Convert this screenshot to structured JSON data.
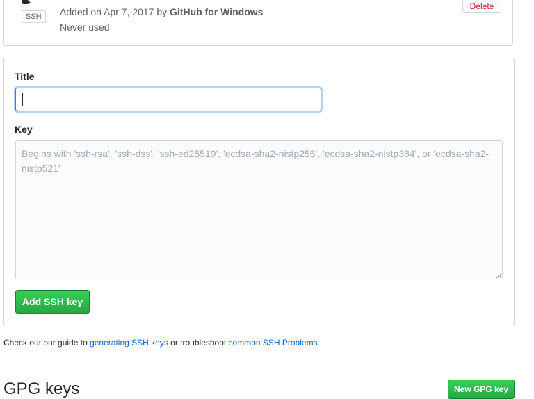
{
  "existing_key": {
    "badge": "SSH",
    "added_prefix": "Added on Apr 7, 2017 by ",
    "added_by": "GitHub for Windows",
    "usage": "Never used",
    "delete_label": "Delete"
  },
  "form": {
    "title_label": "Title",
    "title_value": "",
    "key_label": "Key",
    "key_placeholder": "Begins with 'ssh-rsa', 'ssh-dss', 'ssh-ed25519', 'ecdsa-sha2-nistp256', 'ecdsa-sha2-nistp384', or 'ecdsa-sha2-nistp521'",
    "submit_label": "Add SSH key"
  },
  "guide": {
    "prefix": "Check out our guide to ",
    "link1": "generating SSH keys",
    "middle": " or troubleshoot ",
    "link2": "common SSH Problems",
    "suffix": "."
  },
  "gpg": {
    "heading": "GPG keys",
    "new_button": "New GPG key"
  },
  "colors": {
    "accent_green": "#28a745",
    "link_blue": "#0366d6",
    "danger_red": "#cb2431",
    "focus_blue": "#2188ff"
  }
}
